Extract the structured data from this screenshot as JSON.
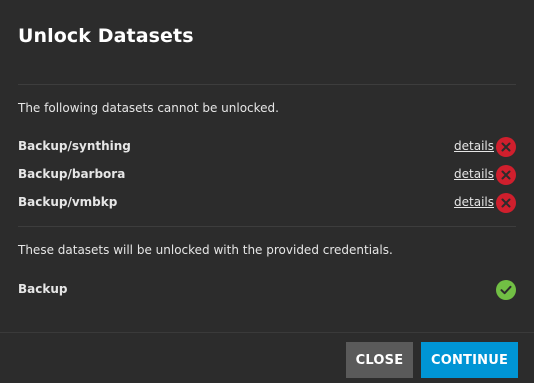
{
  "dialog": {
    "title": "Unlock Datasets",
    "locked_message": "The following datasets cannot be unlocked.",
    "locked_datasets": [
      {
        "name": "Backup/synthing",
        "link": "details",
        "status": "error"
      },
      {
        "name": "Backup/barbora",
        "link": "details",
        "status": "error"
      },
      {
        "name": "Backup/vmbkp",
        "link": "details",
        "status": "error"
      }
    ],
    "unlock_message": "These datasets will be unlocked with the provided credentials.",
    "unlock_datasets": [
      {
        "name": "Backup",
        "status": "ok"
      }
    ],
    "buttons": {
      "close": "CLOSE",
      "continue": "CONTINUE"
    }
  },
  "colors": {
    "background": "#2c2c2c",
    "error": "#d01f2d",
    "ok": "#71bf44",
    "primary": "#0095d5",
    "secondary": "#5a5a5a"
  },
  "icons": {
    "error": "close-circle-icon",
    "ok": "check-circle-icon"
  }
}
